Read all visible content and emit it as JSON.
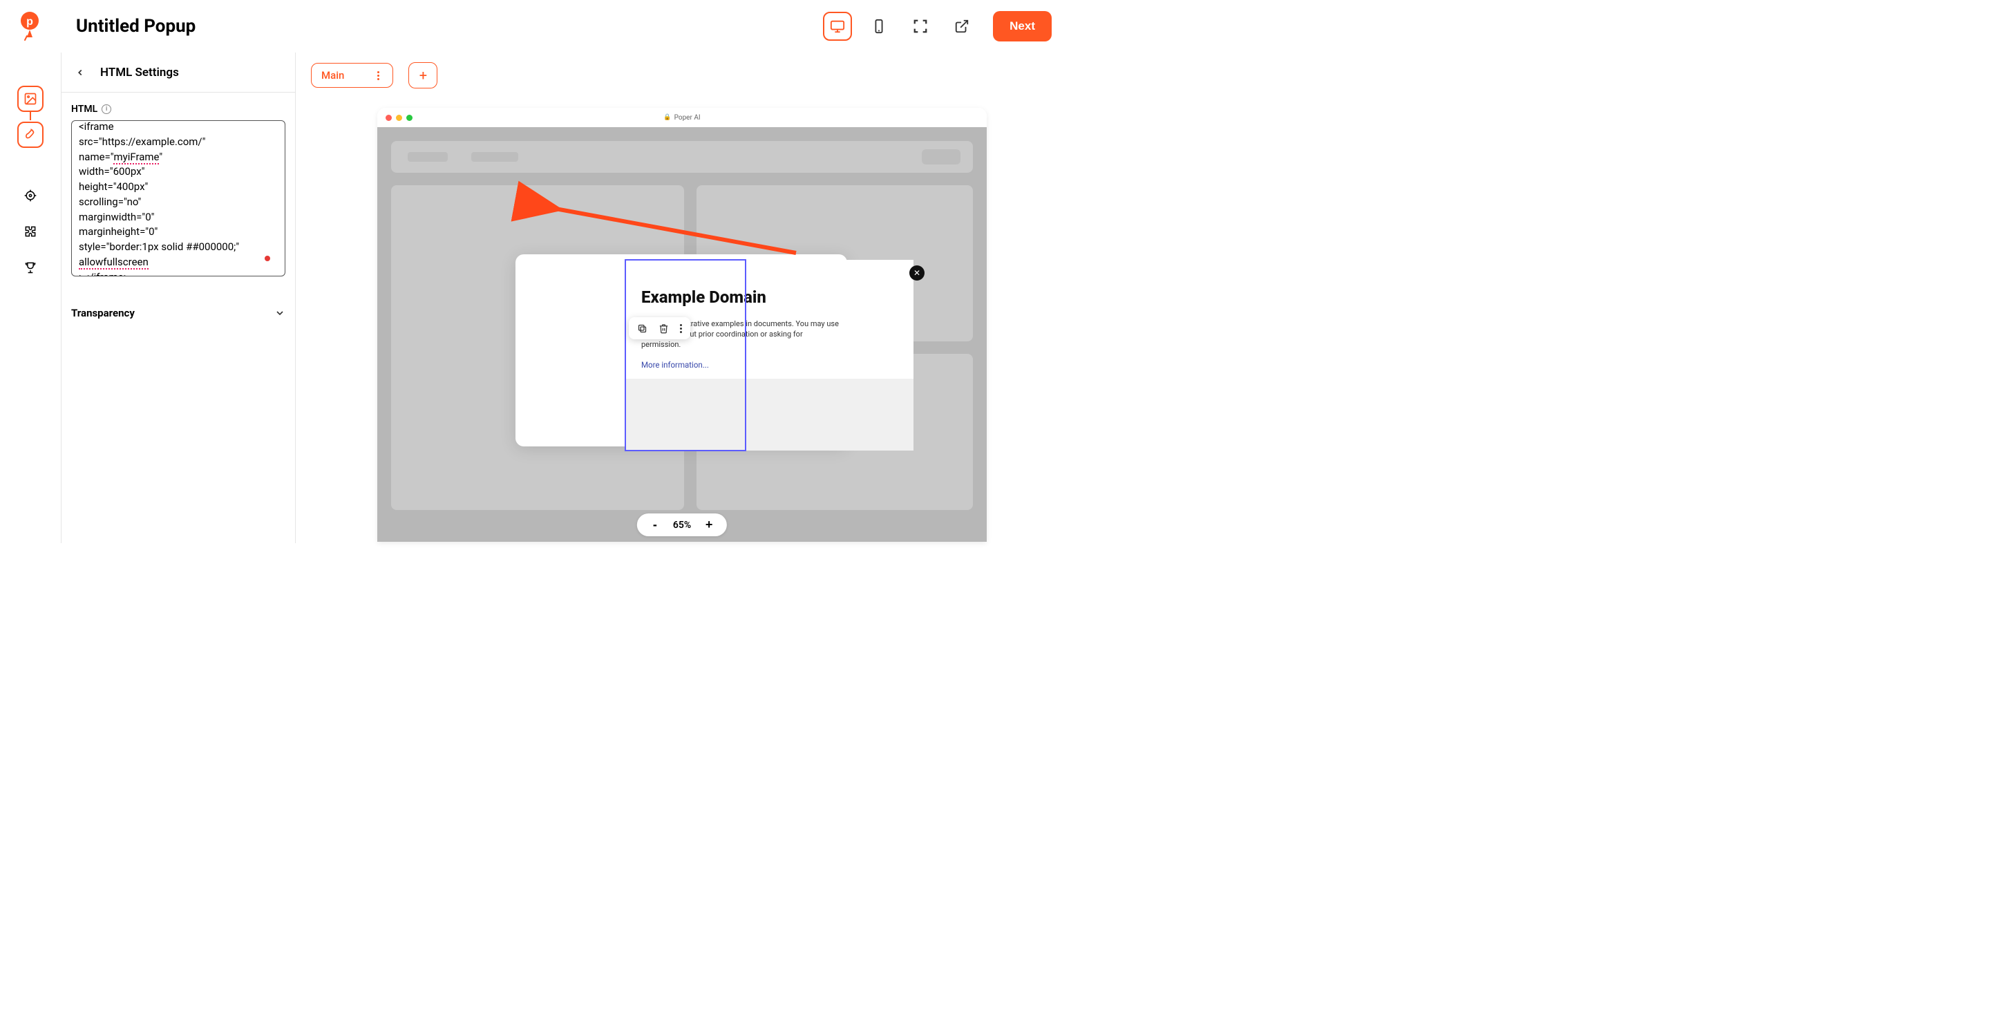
{
  "header": {
    "title": "Untitled Popup",
    "next_label": "Next"
  },
  "panel": {
    "title": "HTML Settings",
    "html_label": "HTML",
    "html_content": "<iframe\nsrc=\"https://example.com/\"\nname=\"myiFrame\"\nwidth=\"600px\"\nheight=\"400px\"\nscrolling=\"no\"\nmarginwidth=\"0\"\nmarginheight=\"0\"\nstyle=\"border:1px solid ##000000;\"\nallowfullscreen\n></iframe>",
    "transparency_label": "Transparency"
  },
  "steps": {
    "main_label": "Main",
    "add_label": "+"
  },
  "browser": {
    "url_host": "Poper AI"
  },
  "popup": {
    "heading": "Example Domain",
    "body_line1": "for use in illustrative examples in documents. You may use",
    "body_line2": "iterature without prior coordination or asking for",
    "body_line3": "permission.",
    "link": "More information..."
  },
  "zoom": {
    "value": "65%",
    "plus": "+",
    "minus": "-"
  }
}
